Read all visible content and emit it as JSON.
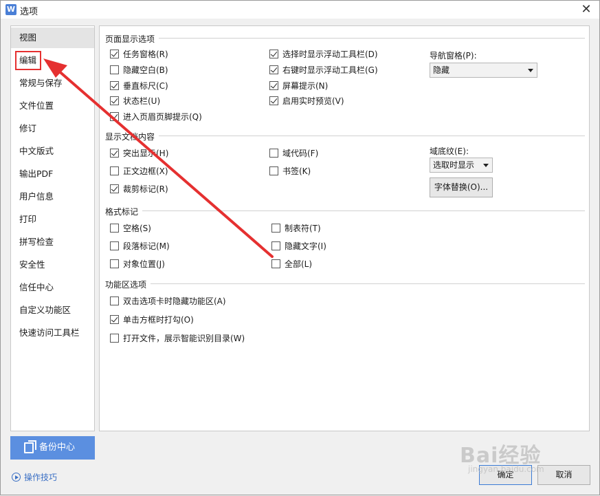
{
  "window": {
    "title": "选项",
    "app_icon": "W"
  },
  "sidebar": {
    "items": [
      {
        "label": "视图"
      },
      {
        "label": "编辑"
      },
      {
        "label": "常规与保存"
      },
      {
        "label": "文件位置"
      },
      {
        "label": "修订"
      },
      {
        "label": "中文版式"
      },
      {
        "label": "输出PDF"
      },
      {
        "label": "用户信息"
      },
      {
        "label": "打印"
      },
      {
        "label": "拼写检查"
      },
      {
        "label": "安全性"
      },
      {
        "label": "信任中心"
      },
      {
        "label": "自定义功能区"
      },
      {
        "label": "快速访问工具栏"
      }
    ],
    "active_index": 0,
    "highlighted_index": 1,
    "backup_label": "备份中心",
    "tips_label": "操作技巧"
  },
  "sections": {
    "page_display": {
      "title": "页面显示选项",
      "options": [
        {
          "label": "任务窗格(R)",
          "checked": true
        },
        {
          "label": "隐藏空白(B)",
          "checked": false
        },
        {
          "label": "垂直标尺(C)",
          "checked": true
        },
        {
          "label": "状态栏(U)",
          "checked": true
        },
        {
          "label": "进入页眉页脚提示(Q)",
          "checked": true
        },
        {
          "label": "选择时显示浮动工具栏(D)",
          "checked": true
        },
        {
          "label": "右键时显示浮动工具栏(G)",
          "checked": true
        },
        {
          "label": "屏幕提示(N)",
          "checked": true
        },
        {
          "label": "启用实时预览(V)",
          "checked": true
        }
      ],
      "nav_pane_label": "导航窗格(P):",
      "nav_pane_value": "隐藏"
    },
    "doc_content": {
      "title": "显示文档内容",
      "options": [
        {
          "label": "突出显示(H)",
          "checked": true
        },
        {
          "label": "正文边框(X)",
          "checked": false
        },
        {
          "label": "裁剪标记(R)",
          "checked": true
        },
        {
          "label": "域代码(F)",
          "checked": false
        },
        {
          "label": "书签(K)",
          "checked": false
        }
      ],
      "field_shading_label": "域底纹(E):",
      "field_shading_value": "选取时显示",
      "font_replace_label": "字体替换(O)..."
    },
    "format_marks": {
      "title": "格式标记",
      "options": [
        {
          "label": "空格(S)",
          "checked": false
        },
        {
          "label": "段落标记(M)",
          "checked": false
        },
        {
          "label": "对象位置(J)",
          "checked": false
        },
        {
          "label": "制表符(T)",
          "checked": false
        },
        {
          "label": "隐藏文字(I)",
          "checked": false
        },
        {
          "label": "全部(L)",
          "checked": false
        }
      ]
    },
    "ribbon": {
      "title": "功能区选项",
      "options": [
        {
          "label": "双击选项卡时隐藏功能区(A)",
          "checked": false
        },
        {
          "label": "单击方框时打勾(O)",
          "checked": true
        },
        {
          "label": "打开文件，展示智能识别目录(W)",
          "checked": false
        }
      ]
    }
  },
  "footer": {
    "ok_label": "确定",
    "cancel_label": "取消"
  },
  "watermark": {
    "text": "Bai经验",
    "sub": "jingyan.baidu.com"
  },
  "colors": {
    "accent": "#5b8fe0",
    "annotation_red": "#e53030"
  }
}
